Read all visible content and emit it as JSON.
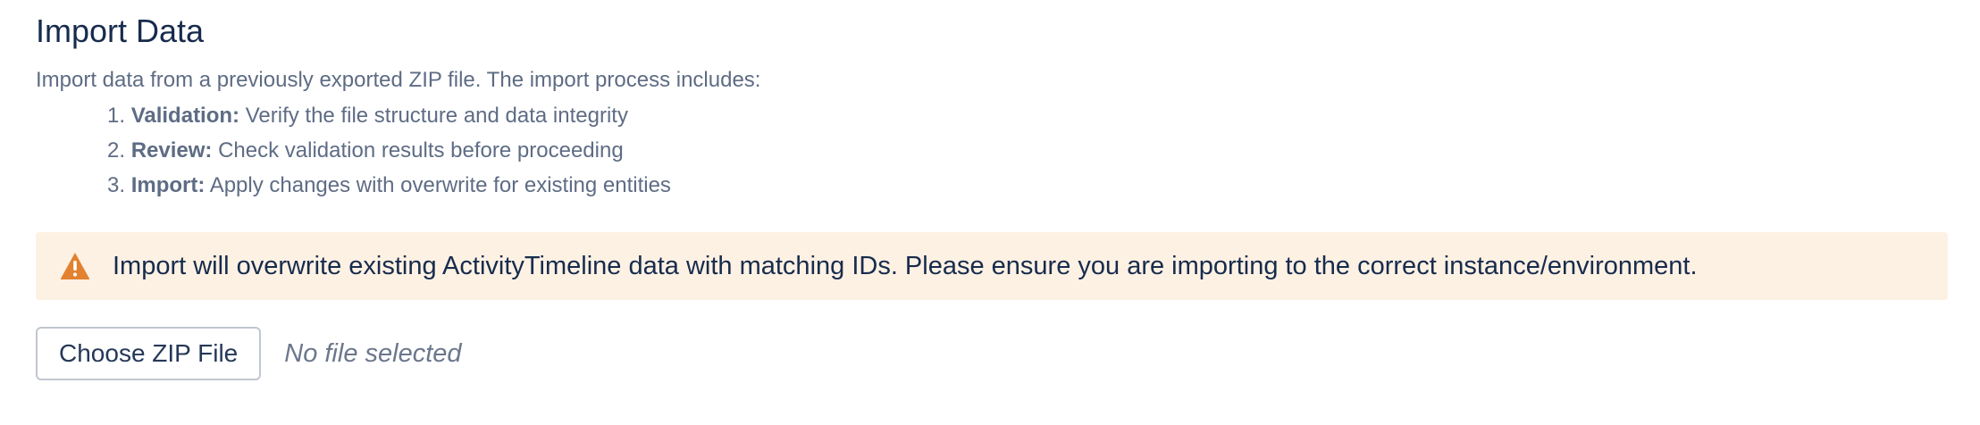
{
  "section": {
    "title": "Import Data",
    "intro": "Import data from a previously exported ZIP file. The import process includes:"
  },
  "steps": [
    {
      "number": "1.",
      "label": "Validation:",
      "text": "Verify the file structure and data integrity"
    },
    {
      "number": "2.",
      "label": "Review:",
      "text": "Check validation results before proceeding"
    },
    {
      "number": "3.",
      "label": "Import:",
      "text": "Apply changes with overwrite for existing entities"
    }
  ],
  "warning": {
    "icon": "warning-icon",
    "text": "Import will overwrite existing ActivityTimeline data with matching IDs. Please ensure you are importing to the correct instance/environment.",
    "background": "#fdf1e3",
    "icon_color": "#e2812f"
  },
  "file_picker": {
    "button_label": "Choose ZIP File",
    "status": "No file selected"
  }
}
